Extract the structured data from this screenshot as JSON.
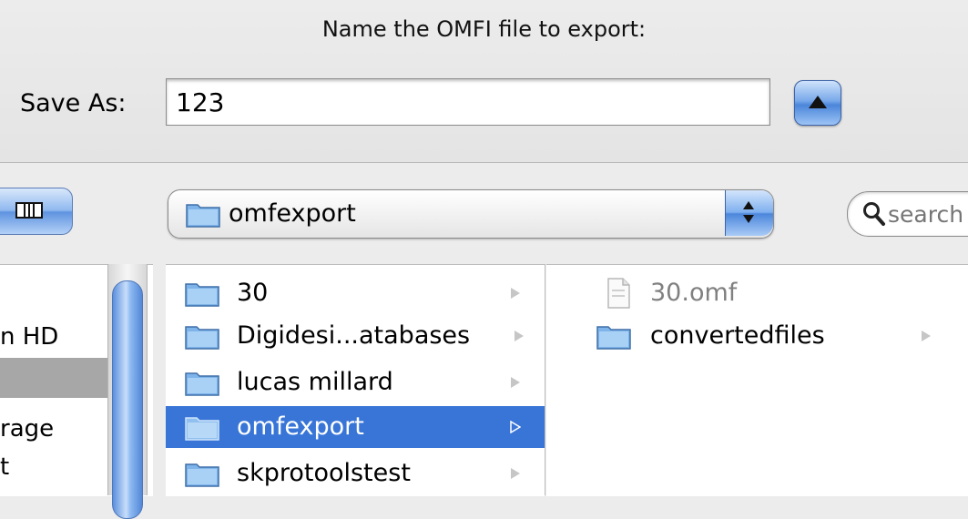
{
  "dialog": {
    "prompt": "Name the OMFI file to export:",
    "save_as_label": "Save As:",
    "save_as_value": "123"
  },
  "toolbar": {
    "location": "omfexport",
    "search_placeholder": "search"
  },
  "sidebar": {
    "items": [
      {
        "label": "n HD",
        "selected": false
      },
      {
        "label": "",
        "selected": true
      },
      {
        "label": "rage",
        "selected": false
      },
      {
        "label": "t",
        "selected": false
      }
    ]
  },
  "browser": {
    "column1": [
      {
        "name": "30",
        "type": "folder",
        "has_children": true
      },
      {
        "name": "Digidesi...atabases",
        "type": "folder",
        "has_children": true
      },
      {
        "name": "lucas millard",
        "type": "folder",
        "has_children": true
      },
      {
        "name": "omfexport",
        "type": "folder",
        "has_children": true,
        "selected": true
      },
      {
        "name": "skprotoolstest",
        "type": "folder",
        "has_children": true
      }
    ],
    "column2": [
      {
        "name": "30.omf",
        "type": "file",
        "has_children": false,
        "disabled": true
      },
      {
        "name": "convertedfiles",
        "type": "folder",
        "has_children": true
      }
    ]
  },
  "colors": {
    "selection": "#3875d7",
    "aqua_blue": "#5f93df",
    "sidebar_selection": "#a7a7a7"
  }
}
